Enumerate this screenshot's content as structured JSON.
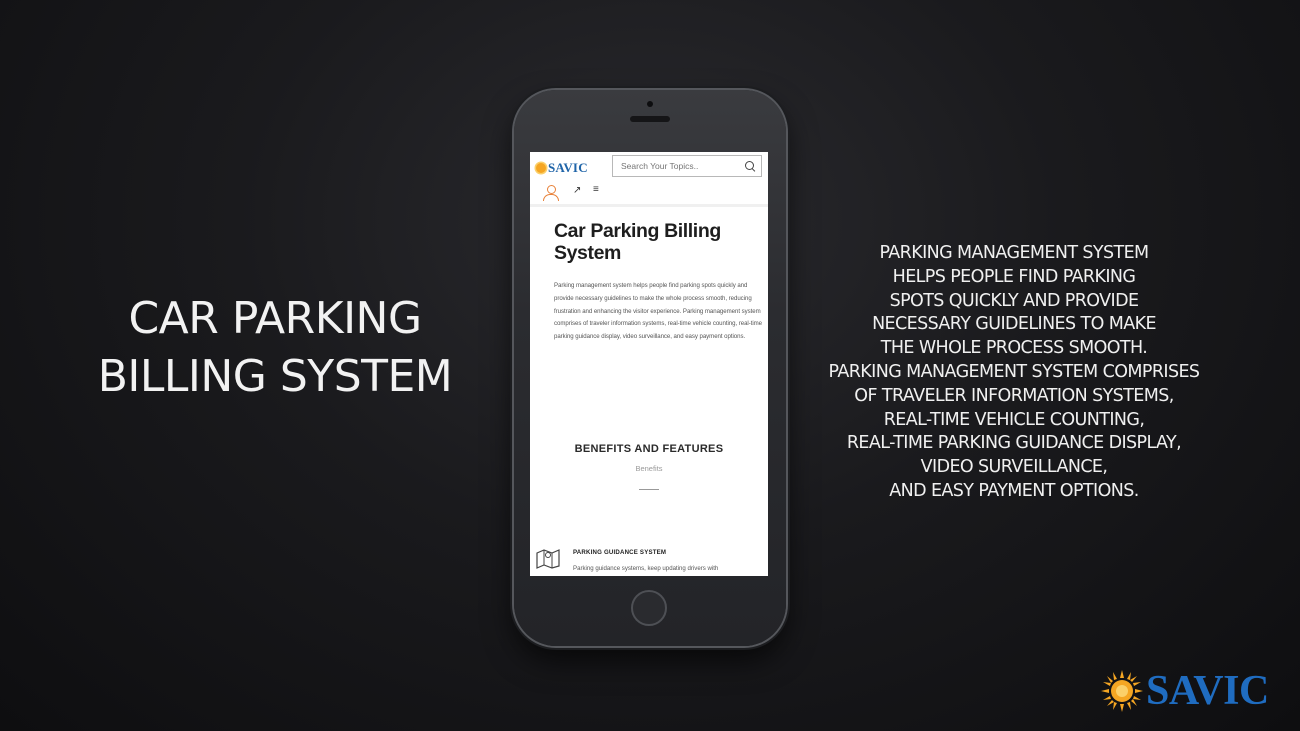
{
  "left_title": [
    "CAR PARKING",
    "BILLING SYSTEM"
  ],
  "right_text": [
    "PARKING MANAGEMENT SYSTEM",
    "HELPS PEOPLE FIND PARKING",
    "SPOTS QUICKLY AND PROVIDE",
    "NECESSARY GUIDELINES TO MAKE",
    "THE WHOLE PROCESS SMOOTH.",
    "PARKING MANAGEMENT SYSTEM COMPRISES",
    "OF TRAVELER INFORMATION SYSTEMS,",
    "REAL-TIME VEHICLE COUNTING,",
    "REAL-TIME PARKING GUIDANCE DISPLAY,",
    "VIDEO SURVEILLANCE,",
    "AND EASY PAYMENT OPTIONS."
  ],
  "phone": {
    "logo_text": "SAVIC",
    "search_placeholder": "Search Your Topics..",
    "share_glyph": "↗",
    "menu_glyph": "≡",
    "page_title": "Car Parking Billing System",
    "description": "Parking management system helps people find parking spots quickly and provide necessary guidelines to make the whole process smooth, reducing frustration and enhancing the visitor experience. Parking management system comprises of traveler information systems, real-time vehicle counting, real-time parking guidance display, video surveillance, and easy payment options.",
    "section_title": "BENEFITS AND FEATURES",
    "section_subtitle": "Benefits",
    "feature_title": "PARKING GUIDANCE SYSTEM",
    "feature_text": "Parking guidance systems, keep updating drivers with"
  },
  "brand": {
    "text": "SAVIC",
    "color": "#1f6cc0",
    "sun_color": "#f5a623"
  }
}
